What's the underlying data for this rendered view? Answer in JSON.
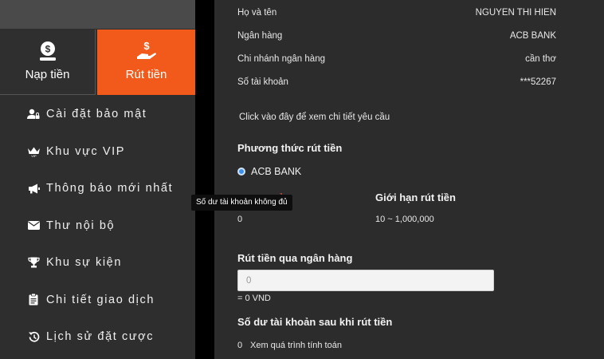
{
  "tabs": {
    "deposit_label": "Nạp tiền",
    "withdraw_label": "Rút tiền"
  },
  "menu": [
    {
      "label": "Cài đặt bảo mật",
      "icon": "user-lock-icon"
    },
    {
      "label": "Khu vực VIP",
      "icon": "crown-icon"
    },
    {
      "label": "Thông báo mới nhất",
      "icon": "megaphone-icon"
    },
    {
      "label": "Thư nội bộ",
      "icon": "envelope-icon"
    },
    {
      "label": "Khu sự kiện",
      "icon": "trophy-icon"
    },
    {
      "label": "Chi tiết giao dịch",
      "icon": "clipboard-icon"
    },
    {
      "label": "Lịch sử đặt cược",
      "icon": "history-icon"
    }
  ],
  "account_info": [
    {
      "label": "Họ và tên",
      "value": "NGUYEN THI HIEN"
    },
    {
      "label": "Ngân hàng",
      "value": "ACB BANK"
    },
    {
      "label": "Chi nhánh ngân hàng",
      "value": "cần thơ"
    },
    {
      "label": "Số tài khoản",
      "value": "***52267"
    }
  ],
  "details_link": "Click vào đây để xem chi tiết yêu cầu",
  "withdraw_method": {
    "title": "Phương thức rút tiền",
    "selected": "ACB BANK"
  },
  "balance": {
    "label_visible": "oản",
    "value": "0"
  },
  "limit": {
    "label": "Giới hạn rút tiền",
    "value": "10 ~ 1,000,000"
  },
  "bank_withdraw": {
    "title": "Rút tiền qua ngân hàng",
    "placeholder": "0",
    "converted": "= 0 VND"
  },
  "after_balance": {
    "title": "Số dư tài khoản sau khi rút tiền",
    "value": "0",
    "link": "Xem quá trình tính toán"
  },
  "tooltip": "Số dư tài khoản không đủ",
  "colors": {
    "accent": "#f25a1c",
    "balance_label": "#d24a3c",
    "radio": "#3b8fe6"
  }
}
